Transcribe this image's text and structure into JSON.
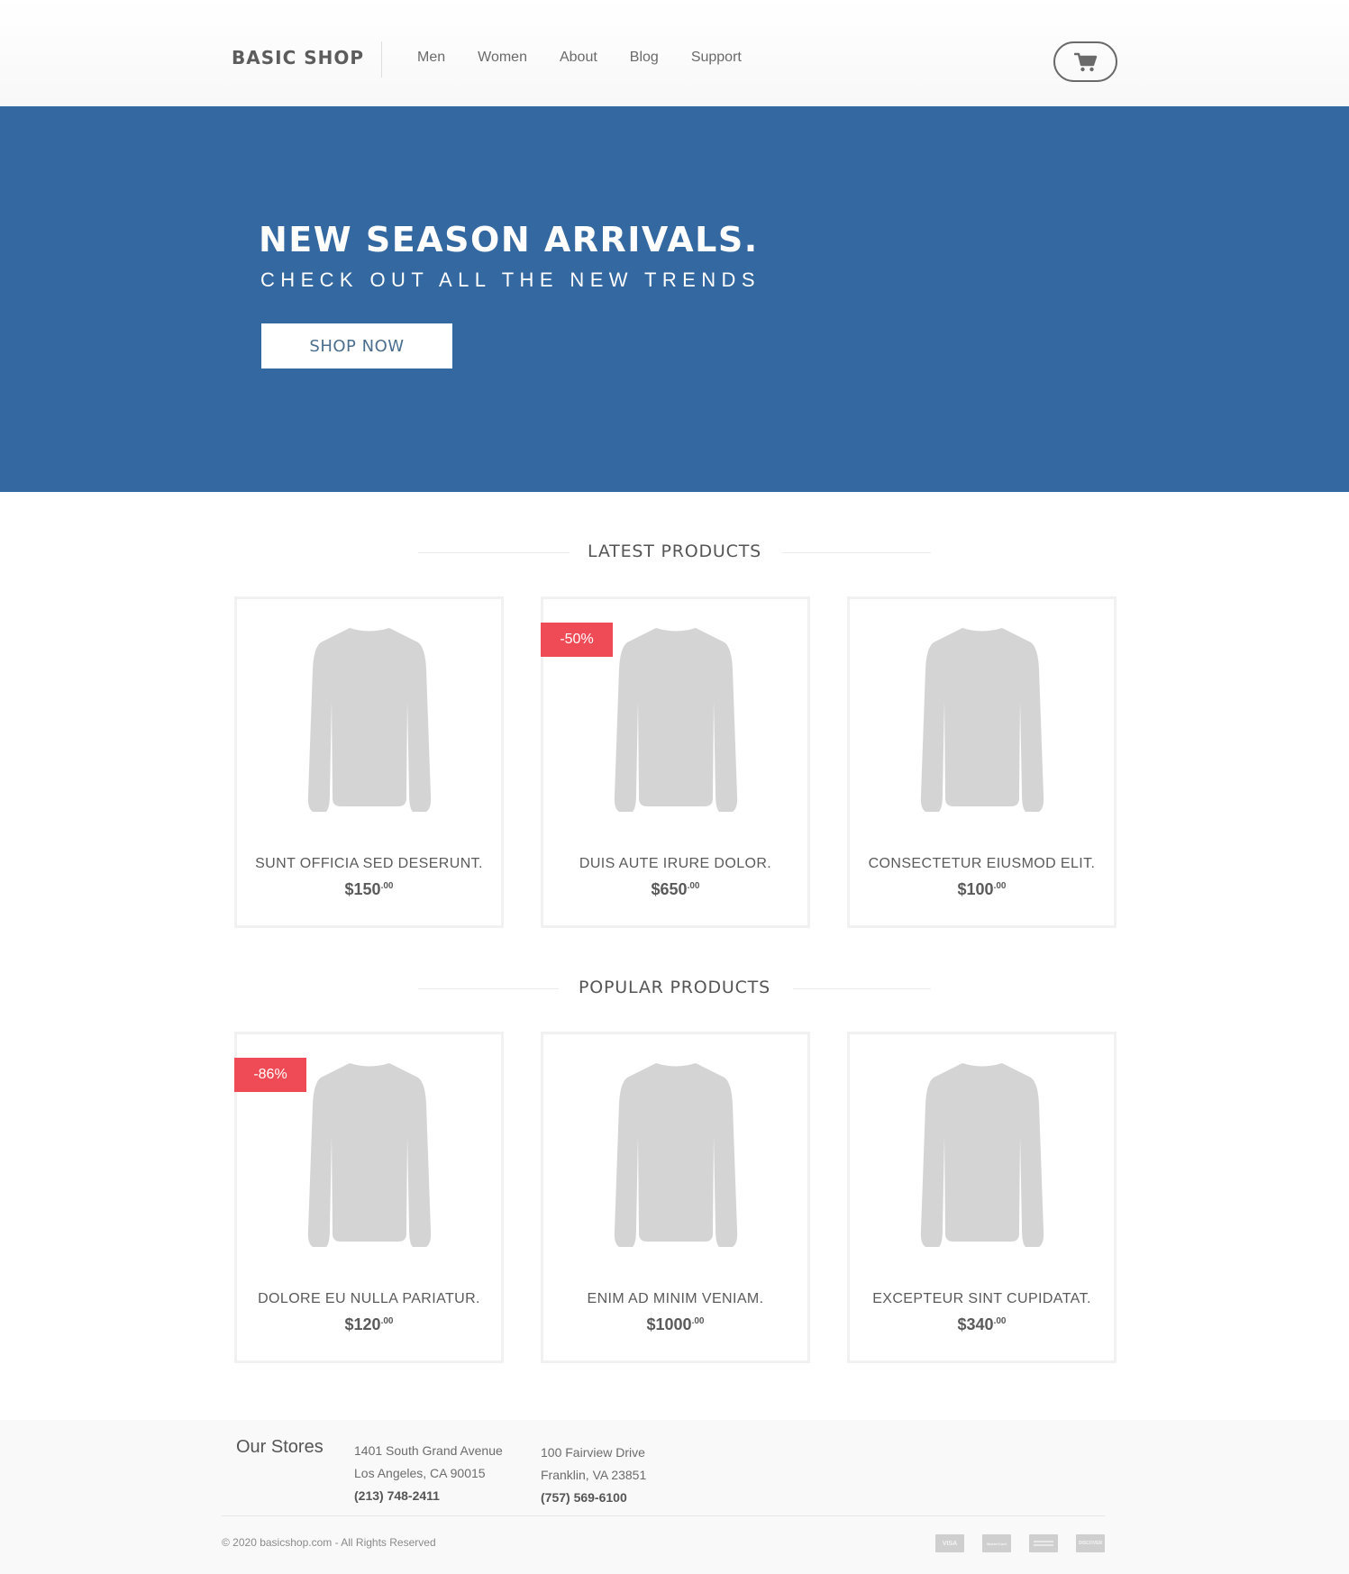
{
  "header": {
    "logo": "BASIC SHOP",
    "nav": [
      "Men",
      "Women",
      "About",
      "Blog",
      "Support"
    ],
    "cart_icon": "shopping-cart-icon"
  },
  "hero": {
    "title": "NEW SEASON ARRIVALS.",
    "subtitle": "CHECK OUT ALL THE NEW TRENDS",
    "button_label": "SHOP NOW",
    "background_color": "#3468a0"
  },
  "latest": {
    "heading": "LATEST PRODUCTS",
    "products": [
      {
        "name": "SUNT OFFICIA SED DESERUNT.",
        "price": "$150",
        "cents": ".00",
        "badge": ""
      },
      {
        "name": "DUIS AUTE IRURE DOLOR.",
        "price": "$650",
        "cents": ".00",
        "badge": "-50%"
      },
      {
        "name": "CONSECTETUR EIUSMOD ELIT.",
        "price": "$100",
        "cents": ".00",
        "badge": ""
      }
    ]
  },
  "popular": {
    "heading": "POPULAR PRODUCTS",
    "products": [
      {
        "name": "DOLORE EU NULLA PARIATUR.",
        "price": "$120",
        "cents": ".00",
        "badge": "-86%"
      },
      {
        "name": "ENIM AD MINIM VENIAM.",
        "price": "$1000",
        "cents": ".00",
        "badge": ""
      },
      {
        "name": "EXCEPTEUR SINT CUPIDATAT.",
        "price": "$340",
        "cents": ".00",
        "badge": ""
      }
    ]
  },
  "colors": {
    "accent": "#3468a0",
    "badge": "#ef4b56",
    "product_image": "#d4d4d4"
  },
  "footer": {
    "title": "Our Stores",
    "stores": [
      {
        "address1": "1401 South Grand Avenue",
        "address2": "Los Angeles, CA 90015",
        "phone": "(213) 748-2411"
      },
      {
        "address1": "100 Fairview Drive",
        "address2": "Franklin, VA 23851",
        "phone": "(757) 569-6100"
      }
    ],
    "copyright": "© 2020 basicshop.com  -  All Rights Reserved",
    "payment_icons": [
      {
        "name": "visa-icon",
        "label": "VISA"
      },
      {
        "name": "mastercard-icon",
        "label": "MasterCard"
      },
      {
        "name": "amex-icon",
        "label": ""
      },
      {
        "name": "discover-icon",
        "label": "DISCOVER"
      }
    ]
  }
}
